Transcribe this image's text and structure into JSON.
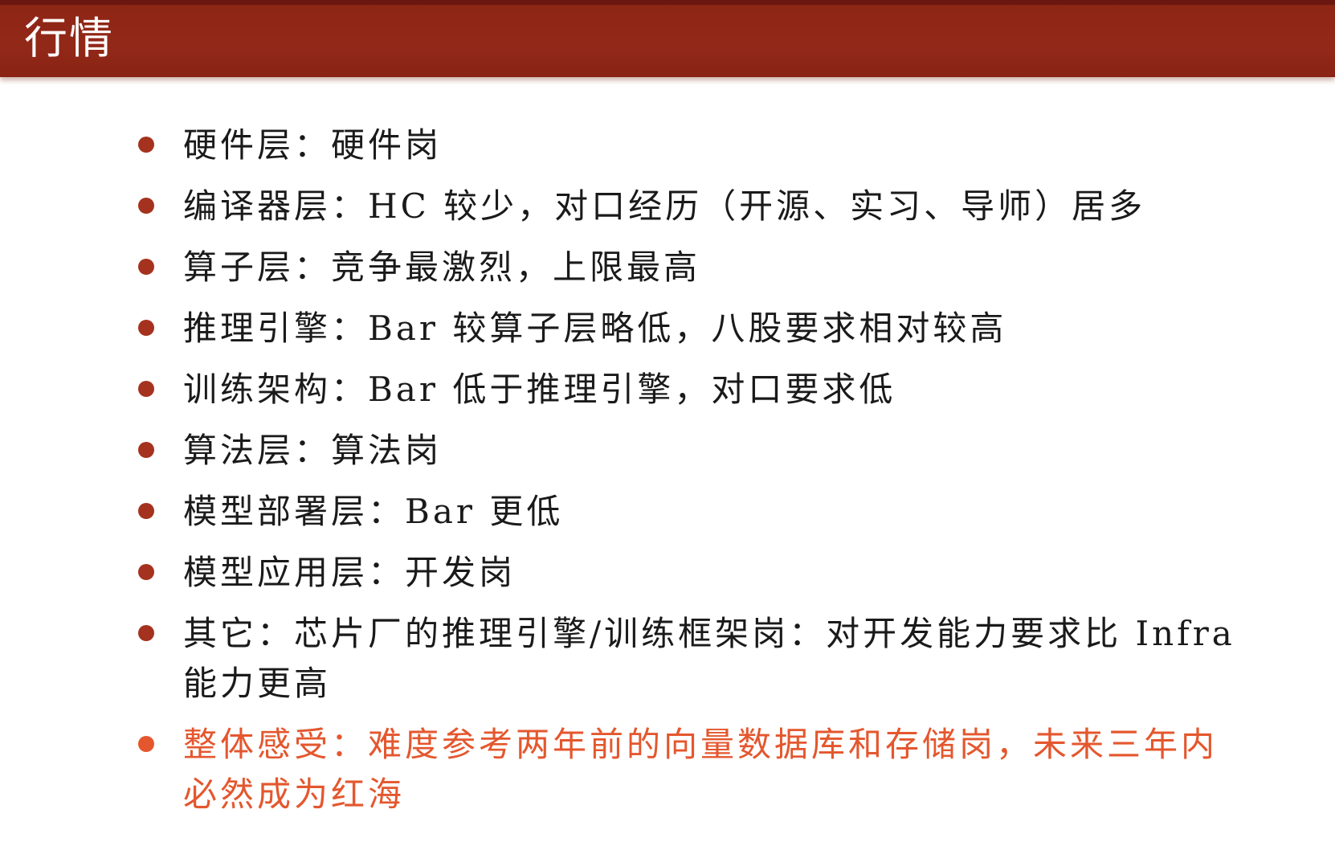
{
  "header": {
    "title": "行情"
  },
  "bullets": [
    {
      "text": "硬件层：硬件岗"
    },
    {
      "text": "编译器层：HC 较少，对口经历（开源、实习、导师）居多"
    },
    {
      "text": "算子层：竞争最激烈，上限最高"
    },
    {
      "text": "推理引擎：Bar 较算子层略低，八股要求相对较高"
    },
    {
      "text": "训练架构：Bar 低于推理引擎，对口要求低"
    },
    {
      "text": "算法层：算法岗"
    },
    {
      "text": "模型部署层：Bar 更低"
    },
    {
      "text": "模型应用层：开发岗"
    },
    {
      "text": "其它：芯片厂的推理引擎/训练框架岗：对开发能力要求比 Infra 能力更高"
    },
    {
      "text": "整体感受：难度参考两年前的向量数据库和存储岗，未来三年内必然成为红海"
    }
  ],
  "colors": {
    "title_bar": "#922818",
    "bullet_dot": "#a5321e",
    "highlight_text": "#e4572e",
    "body_text": "#1a1a1a"
  }
}
